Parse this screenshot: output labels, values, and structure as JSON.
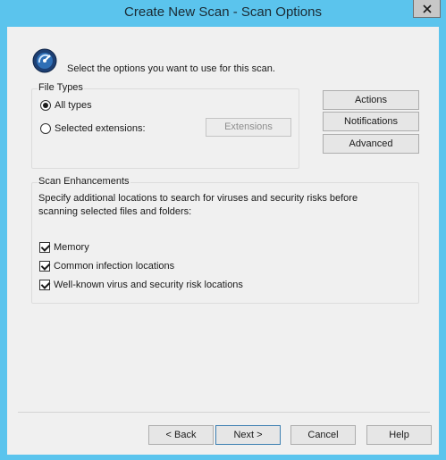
{
  "window": {
    "title": "Create New Scan - Scan Options"
  },
  "intro": {
    "text": "Select the options you want to use for this scan.",
    "icon": "scan-options-icon"
  },
  "file_types": {
    "label": "File Types",
    "all_types": "All types",
    "selected_extensions": "Selected extensions:",
    "extensions_button": "Extensions",
    "selected": "all_types"
  },
  "side_buttons": {
    "actions": "Actions",
    "notifications": "Notifications",
    "advanced": "Advanced"
  },
  "enhancements": {
    "label": "Scan Enhancements",
    "description_line1": "Specify additional locations to search for viruses and security risks before",
    "description_line2": "scanning selected files and folders:",
    "memory": "Memory",
    "common_infection": "Common infection locations",
    "well_known": "Well-known virus and security risk locations",
    "memory_checked": true,
    "common_infection_checked": true,
    "well_known_checked": true
  },
  "footer": {
    "back": "< Back",
    "next": "Next >",
    "cancel": "Cancel",
    "help": "Help"
  },
  "colors": {
    "title_bar": "#5bc4ed",
    "dialog_bg": "#f0f0f0",
    "close_button": "#c7c7c7"
  }
}
